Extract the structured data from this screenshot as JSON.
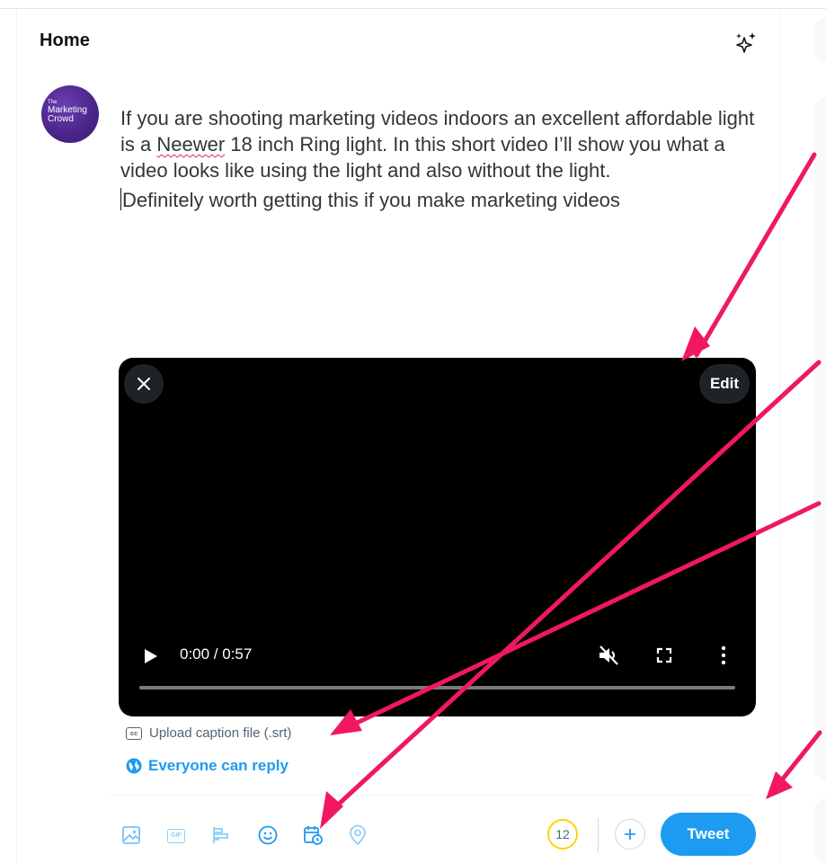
{
  "header": {
    "title": "Home"
  },
  "avatar": {
    "line1": "The",
    "line2": "Marketing",
    "line3": "Crowd"
  },
  "tweet": {
    "para1_before": "If you are shooting marketing videos indoors an excellent affordable light is a ",
    "para1_misspelled": "Neewer",
    "para1_after": " 18 inch Ring light. In this short video I’ll show you what a video looks like using the light and also without the light.",
    "para2": "Definitely worth getting this if you make marketing videos"
  },
  "video": {
    "edit_label": "Edit",
    "time": "0:00 / 0:57",
    "progress": 0
  },
  "caption": {
    "cc_label": "cc",
    "upload_label": "Upload caption file (.srt)"
  },
  "reply": {
    "label": "Everyone can reply"
  },
  "toolbar": {
    "icons": [
      "image-icon",
      "gif-icon",
      "poll-icon",
      "emoji-icon",
      "schedule-icon",
      "location-icon"
    ],
    "gif_label": "GIF",
    "counter": "12",
    "tweet_label": "Tweet"
  },
  "colors": {
    "accent": "#1d9bf0",
    "annotation_arrow": "#f0185f",
    "counter_ring": "#ffd400",
    "avatar_bg": "#4a2489"
  }
}
